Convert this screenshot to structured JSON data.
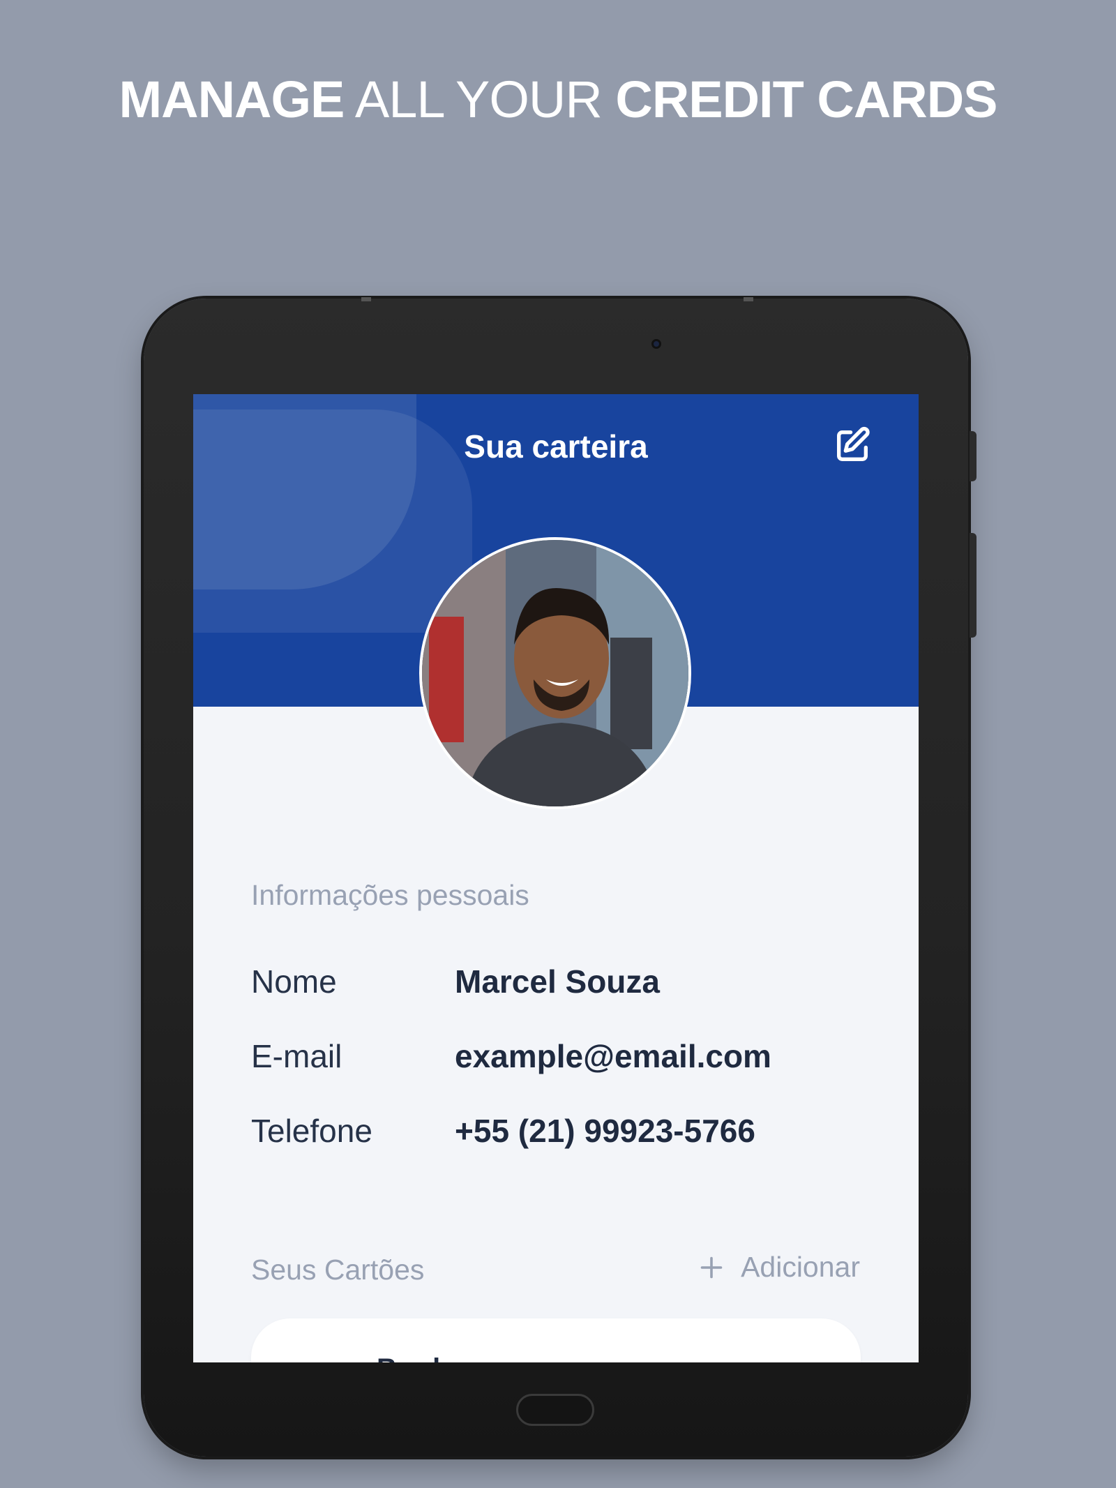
{
  "promo": {
    "word1": "MANAGE",
    "word2": " ALL YOUR ",
    "word3": "CREDIT CARDS"
  },
  "app": {
    "title": "Sua carteira",
    "edit_icon": "edit-icon"
  },
  "profile": {
    "avatar": "profile-photo"
  },
  "personal_info": {
    "section_title": "Informações pessoais",
    "rows": [
      {
        "label": "Nome",
        "value": "Marcel Souza"
      },
      {
        "label": "E-mail",
        "value": "example@email.com"
      },
      {
        "label": "Telefone",
        "value": "+55 (21) 99923-5766"
      }
    ]
  },
  "cards": {
    "section_title": "Seus Cartões",
    "add_icon": "plus-icon",
    "add_label": "Adicionar",
    "first_card_peek": "Bradesco"
  },
  "colors": {
    "background": "#939bab",
    "header_blue": "#18449e",
    "screen_bg": "#f3f5f9",
    "muted_text": "#98a1b3",
    "dark_text": "#1f2a40"
  }
}
